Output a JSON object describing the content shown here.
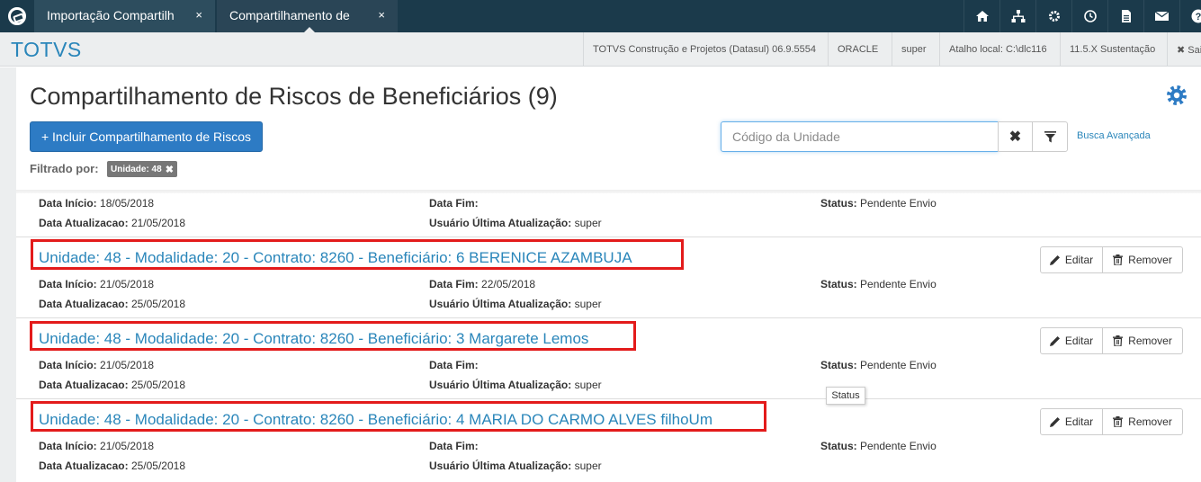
{
  "tabs": [
    {
      "label": "Importação Compartilh",
      "close": "×"
    },
    {
      "label": "Compartilhamento de",
      "close": "×"
    }
  ],
  "top_icons": [
    "home-icon",
    "sitemap-icon",
    "settings-icon",
    "clock-icon",
    "document-icon",
    "mail-icon",
    "help-icon"
  ],
  "header": {
    "brand": "TOTVS",
    "product": "TOTVS Construção e Projetos (Datasul) 06.9.5554",
    "database": "ORACLE",
    "user": "super",
    "shortcut": "Atalho local: C:\\dlc116",
    "version": "11.5.X Sustentação",
    "exit": "✖ Sai"
  },
  "page": {
    "title": "Compartilhamento de Riscos de Beneficiários (9)",
    "add_button": "+ Incluir Compartilhamento de Riscos",
    "search_placeholder": "Código da Unidade",
    "advanced_search": "Busca Avançada",
    "filtered_by": "Filtrado por:",
    "filter_badge": "Unidade: 48"
  },
  "labels": {
    "start": "Data Início:",
    "end": "Data Fim:",
    "status": "Status:",
    "updated": "Data Atualizacao:",
    "last_user": "Usuário Última Atualização:",
    "edit": "Editar",
    "remove": "Remover"
  },
  "rows": [
    {
      "title": "",
      "start": "18/05/2018",
      "end": "",
      "status": "Pendente Envio",
      "updated": "21/05/2018",
      "last_user": "super"
    },
    {
      "title": "Unidade: 48 - Modalidade: 20 - Contrato: 8260 - Beneficiário: 6 BERENICE AZAMBUJA",
      "start": "21/05/2018",
      "end": "22/05/2018",
      "status": "Pendente Envio",
      "updated": "25/05/2018",
      "last_user": "super"
    },
    {
      "title": "Unidade: 48 - Modalidade: 20 - Contrato: 8260 - Beneficiário: 3 Margarete Lemos",
      "start": "21/05/2018",
      "end": "",
      "status": "Pendente Envio",
      "updated": "25/05/2018",
      "last_user": "super"
    },
    {
      "title": "Unidade: 48 - Modalidade: 20 - Contrato: 8260 - Beneficiário: 4 MARIA DO CARMO ALVES filhoUm",
      "start": "21/05/2018",
      "end": "",
      "status": "Pendente Envio",
      "updated": "25/05/2018",
      "last_user": "super"
    }
  ],
  "tooltip": "Status",
  "colors": {
    "topbar": "#1b3a4b",
    "brand": "#2a86ba",
    "primary_button": "#2d7bc4",
    "highlight": "#e31b1b"
  }
}
